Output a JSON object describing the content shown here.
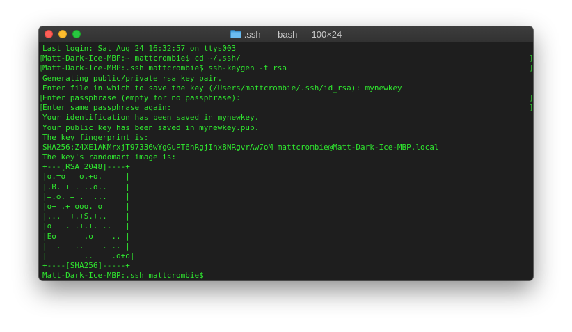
{
  "window": {
    "title": ".ssh — -bash — 100×24",
    "controls": [
      "close",
      "minimize",
      "zoom"
    ],
    "folder_icon": "folder-icon",
    "text_color": "#2fe62f",
    "background": "#1e1e1e"
  },
  "terminal": {
    "lines": [
      {
        "text": "Last login: Sat Aug 24 16:32:57 on ttys003",
        "bracketed": false
      },
      {
        "text": "Matt-Dark-Ice-MBP:~ mattcrombie$ cd ~/.ssh/",
        "bracketed": true
      },
      {
        "text": "Matt-Dark-Ice-MBP:.ssh mattcrombie$ ssh-keygen -t rsa",
        "bracketed": true
      },
      {
        "text": "Generating public/private rsa key pair.",
        "bracketed": false
      },
      {
        "text": "Enter file in which to save the key (/Users/mattcrombie/.ssh/id_rsa): mynewkey",
        "bracketed": false
      },
      {
        "text": "Enter passphrase (empty for no passphrase):",
        "bracketed": true
      },
      {
        "text": "Enter same passphrase again:",
        "bracketed": true
      },
      {
        "text": "Your identification has been saved in mynewkey.",
        "bracketed": false
      },
      {
        "text": "Your public key has been saved in mynewkey.pub.",
        "bracketed": false
      },
      {
        "text": "The key fingerprint is:",
        "bracketed": false
      },
      {
        "text": "SHA256:Z4XE1AKMrxjT97336wYgGuPT6hRgjIhx8NRgvrAw7oM mattcrombie@Matt-Dark-Ice-MBP.local",
        "bracketed": false
      },
      {
        "text": "The key's randomart image is:",
        "bracketed": false
      },
      {
        "text": "+---[RSA 2048]----+",
        "bracketed": false
      },
      {
        "text": "|o.=o   o.+o.     |",
        "bracketed": false
      },
      {
        "text": "|.B. + . ..o..    |",
        "bracketed": false
      },
      {
        "text": "|=.o. = .  ...    |",
        "bracketed": false
      },
      {
        "text": "|o+ .+ ooo. o     |",
        "bracketed": false
      },
      {
        "text": "|...  +.+S.+..    |",
        "bracketed": false
      },
      {
        "text": "|o   . .+.+. ..   |",
        "bracketed": false
      },
      {
        "text": "|Eo      .o    .. |",
        "bracketed": false
      },
      {
        "text": "|  .   ..    . .. |",
        "bracketed": false
      },
      {
        "text": "|        ..    .o+o|",
        "bracketed": false
      },
      {
        "text": "+----[SHA256]-----+",
        "bracketed": false
      },
      {
        "text": "Matt-Dark-Ice-MBP:.ssh mattcrombie$ ",
        "bracketed": false
      }
    ]
  }
}
